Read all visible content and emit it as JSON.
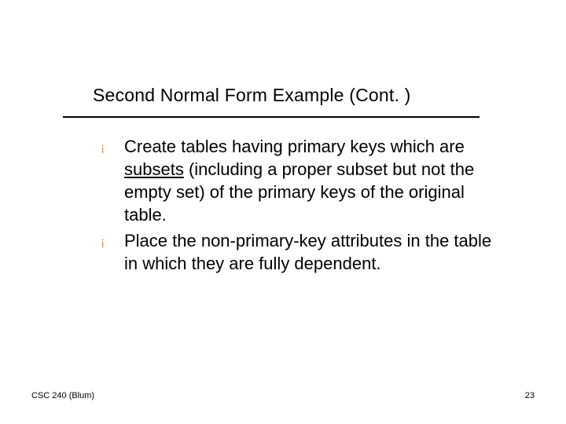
{
  "title": "Second Normal Form Example (Cont. )",
  "bullets": [
    {
      "pre": "Create tables having primary keys which are ",
      "underlined": "subsets",
      "post": " (including a proper subset but not the empty set) of the primary keys of the original table."
    },
    {
      "pre": "Place the non-primary-key attributes in the table in which they are fully dependent.",
      "underlined": "",
      "post": ""
    }
  ],
  "bullet_glyph": "¡",
  "footer": {
    "left": "CSC 240 (Blum)",
    "right": "23"
  }
}
